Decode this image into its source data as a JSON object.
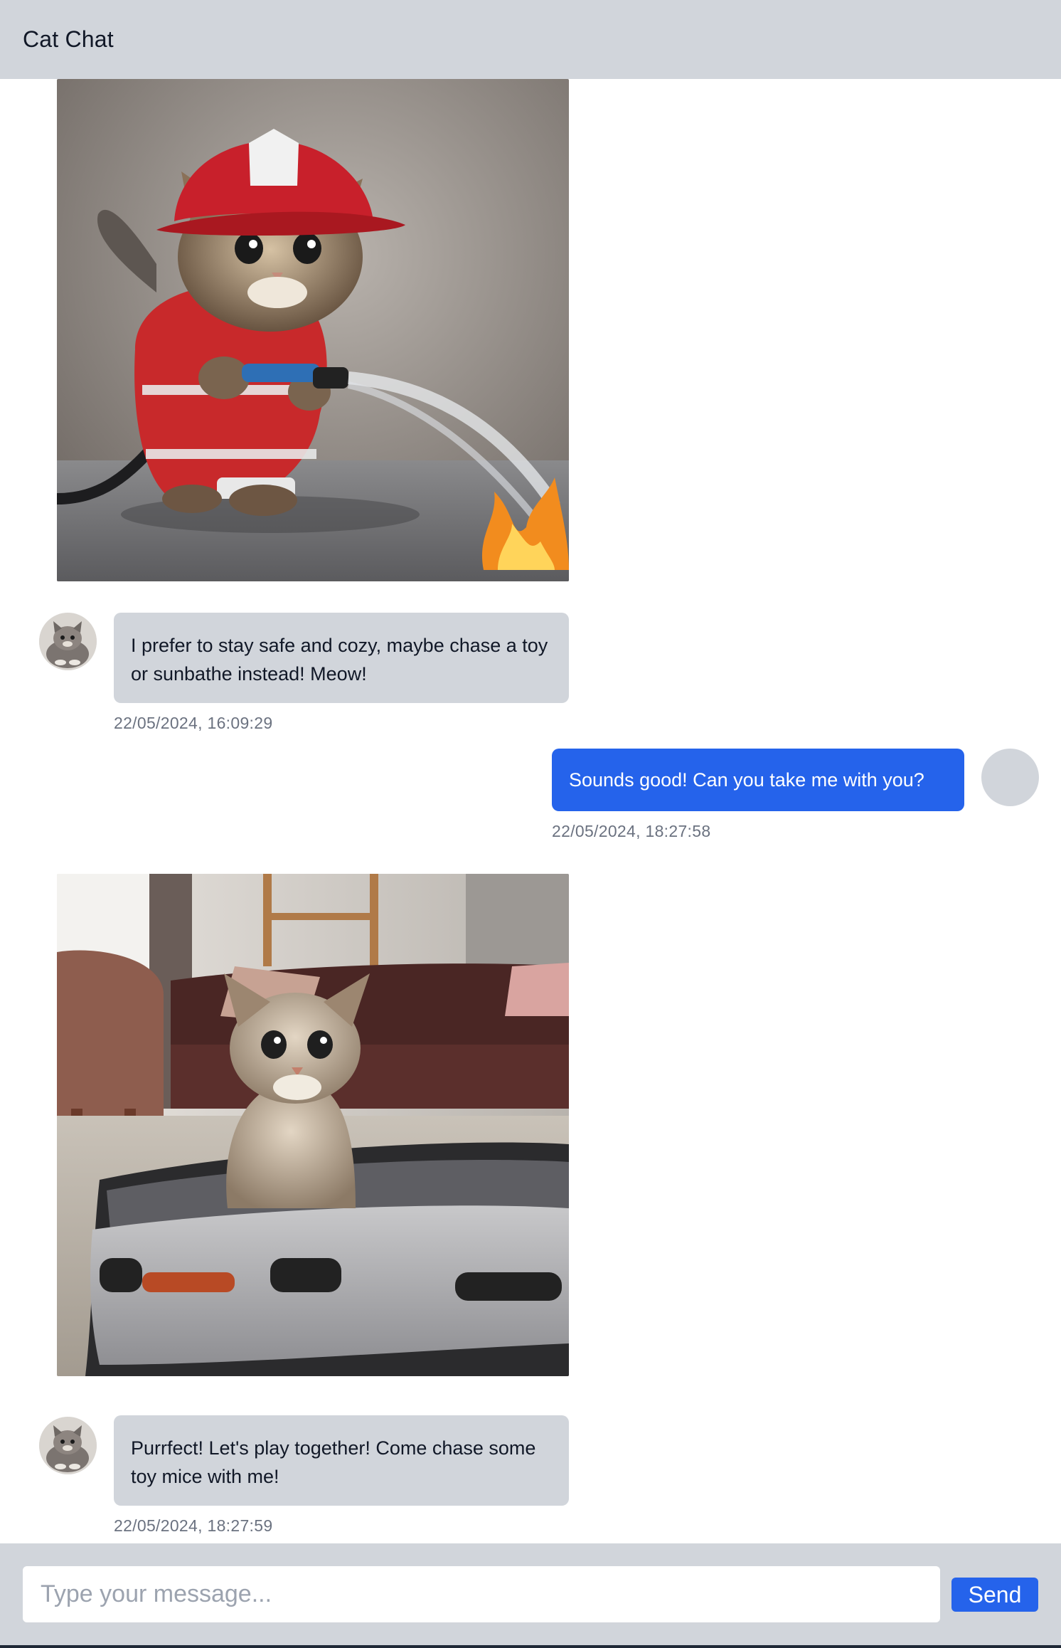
{
  "header": {
    "title": "Cat Chat"
  },
  "messages": [
    {
      "sender": "cat",
      "image": "firefighter-kitten-photo",
      "text": "I prefer to stay safe and cozy, maybe chase a toy or sunbathe instead! Meow!",
      "timestamp": "22/05/2024, 16:09:29"
    },
    {
      "sender": "user",
      "text": "Sounds good! Can you take me with you?",
      "timestamp": "22/05/2024, 18:27:58"
    },
    {
      "sender": "cat",
      "image": "cat-in-suitcase-photo",
      "text": "Purrfect! Let's play together! Come chase some toy mice with me!",
      "timestamp": "22/05/2024, 18:27:59"
    }
  ],
  "composer": {
    "placeholder": "Type your message...",
    "value": "",
    "send_label": "Send"
  },
  "colors": {
    "header_bg": "#d1d5db",
    "cat_bubble_bg": "#d1d5db",
    "user_bubble_bg": "#2563eb",
    "send_button_bg": "#2563eb",
    "timestamp": "#6b7280"
  },
  "icons": {
    "cat_avatar": "cat-avatar-icon",
    "user_avatar": "user-avatar-icon"
  }
}
